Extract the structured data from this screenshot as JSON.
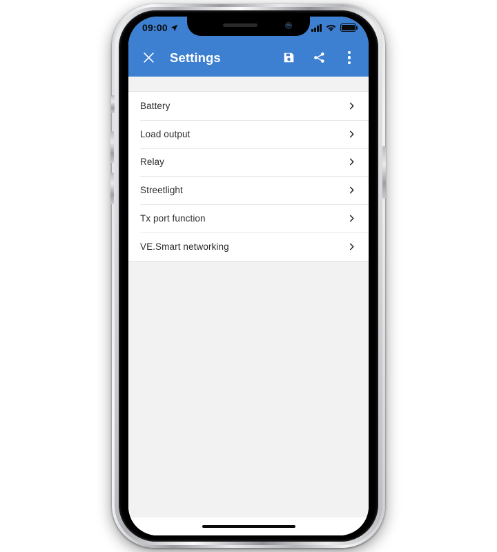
{
  "device": {
    "type": "smartphone",
    "frame_color": "#c9cacd",
    "bezel_color": "#000000",
    "screen_background": "#f2f2f2"
  },
  "status_bar": {
    "time": "09:00",
    "location_icon": "location-arrow-icon",
    "signal_icon": "cellular-signal-icon",
    "signal_bars": 4,
    "wifi_icon": "wifi-icon",
    "battery_icon": "battery-full-icon",
    "battery_level": 85,
    "background": "#3d7fd1",
    "icon_color": "#0b0b0b"
  },
  "app_bar": {
    "background": "#3d7fd1",
    "title": "Settings",
    "close_icon": "close-icon",
    "close_label": "Close",
    "actions": [
      {
        "icon": "save-icon",
        "label": "Save"
      },
      {
        "icon": "share-icon",
        "label": "Share"
      },
      {
        "icon": "overflow-menu-icon",
        "label": "More options"
      }
    ]
  },
  "settings_list": {
    "chevron_icon": "chevron-right-icon",
    "items": [
      {
        "label": "Battery"
      },
      {
        "label": "Load output"
      },
      {
        "label": "Relay"
      },
      {
        "label": "Streetlight"
      },
      {
        "label": "Tx port function"
      },
      {
        "label": "VE.Smart networking"
      }
    ]
  },
  "home_indicator": {
    "name": "home-indicator",
    "color": "#0a0a0a"
  }
}
